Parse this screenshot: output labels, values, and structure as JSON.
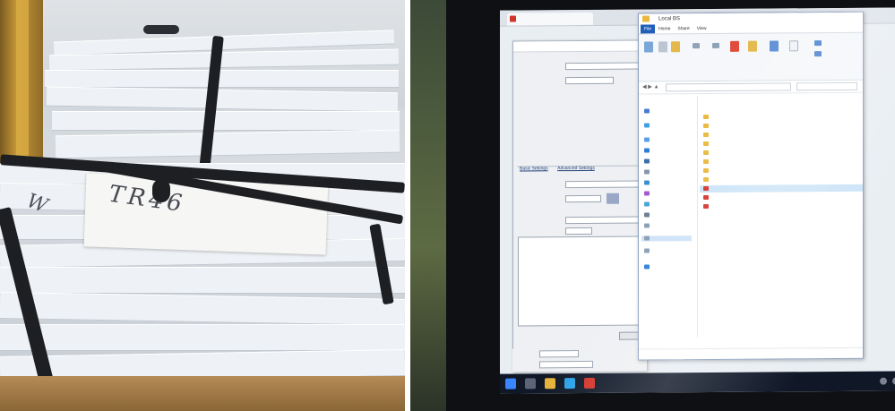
{
  "left_photo": {
    "handwriting_1": "TR46",
    "handwriting_2": "W"
  },
  "right_photo": {
    "explorer": {
      "title": "Local BS",
      "ribbon_tabs": [
        "File",
        "Home",
        "Share",
        "View"
      ]
    },
    "form_dialog": {
      "tabs": [
        "Basic Settings",
        "Advanced Settings"
      ]
    }
  }
}
